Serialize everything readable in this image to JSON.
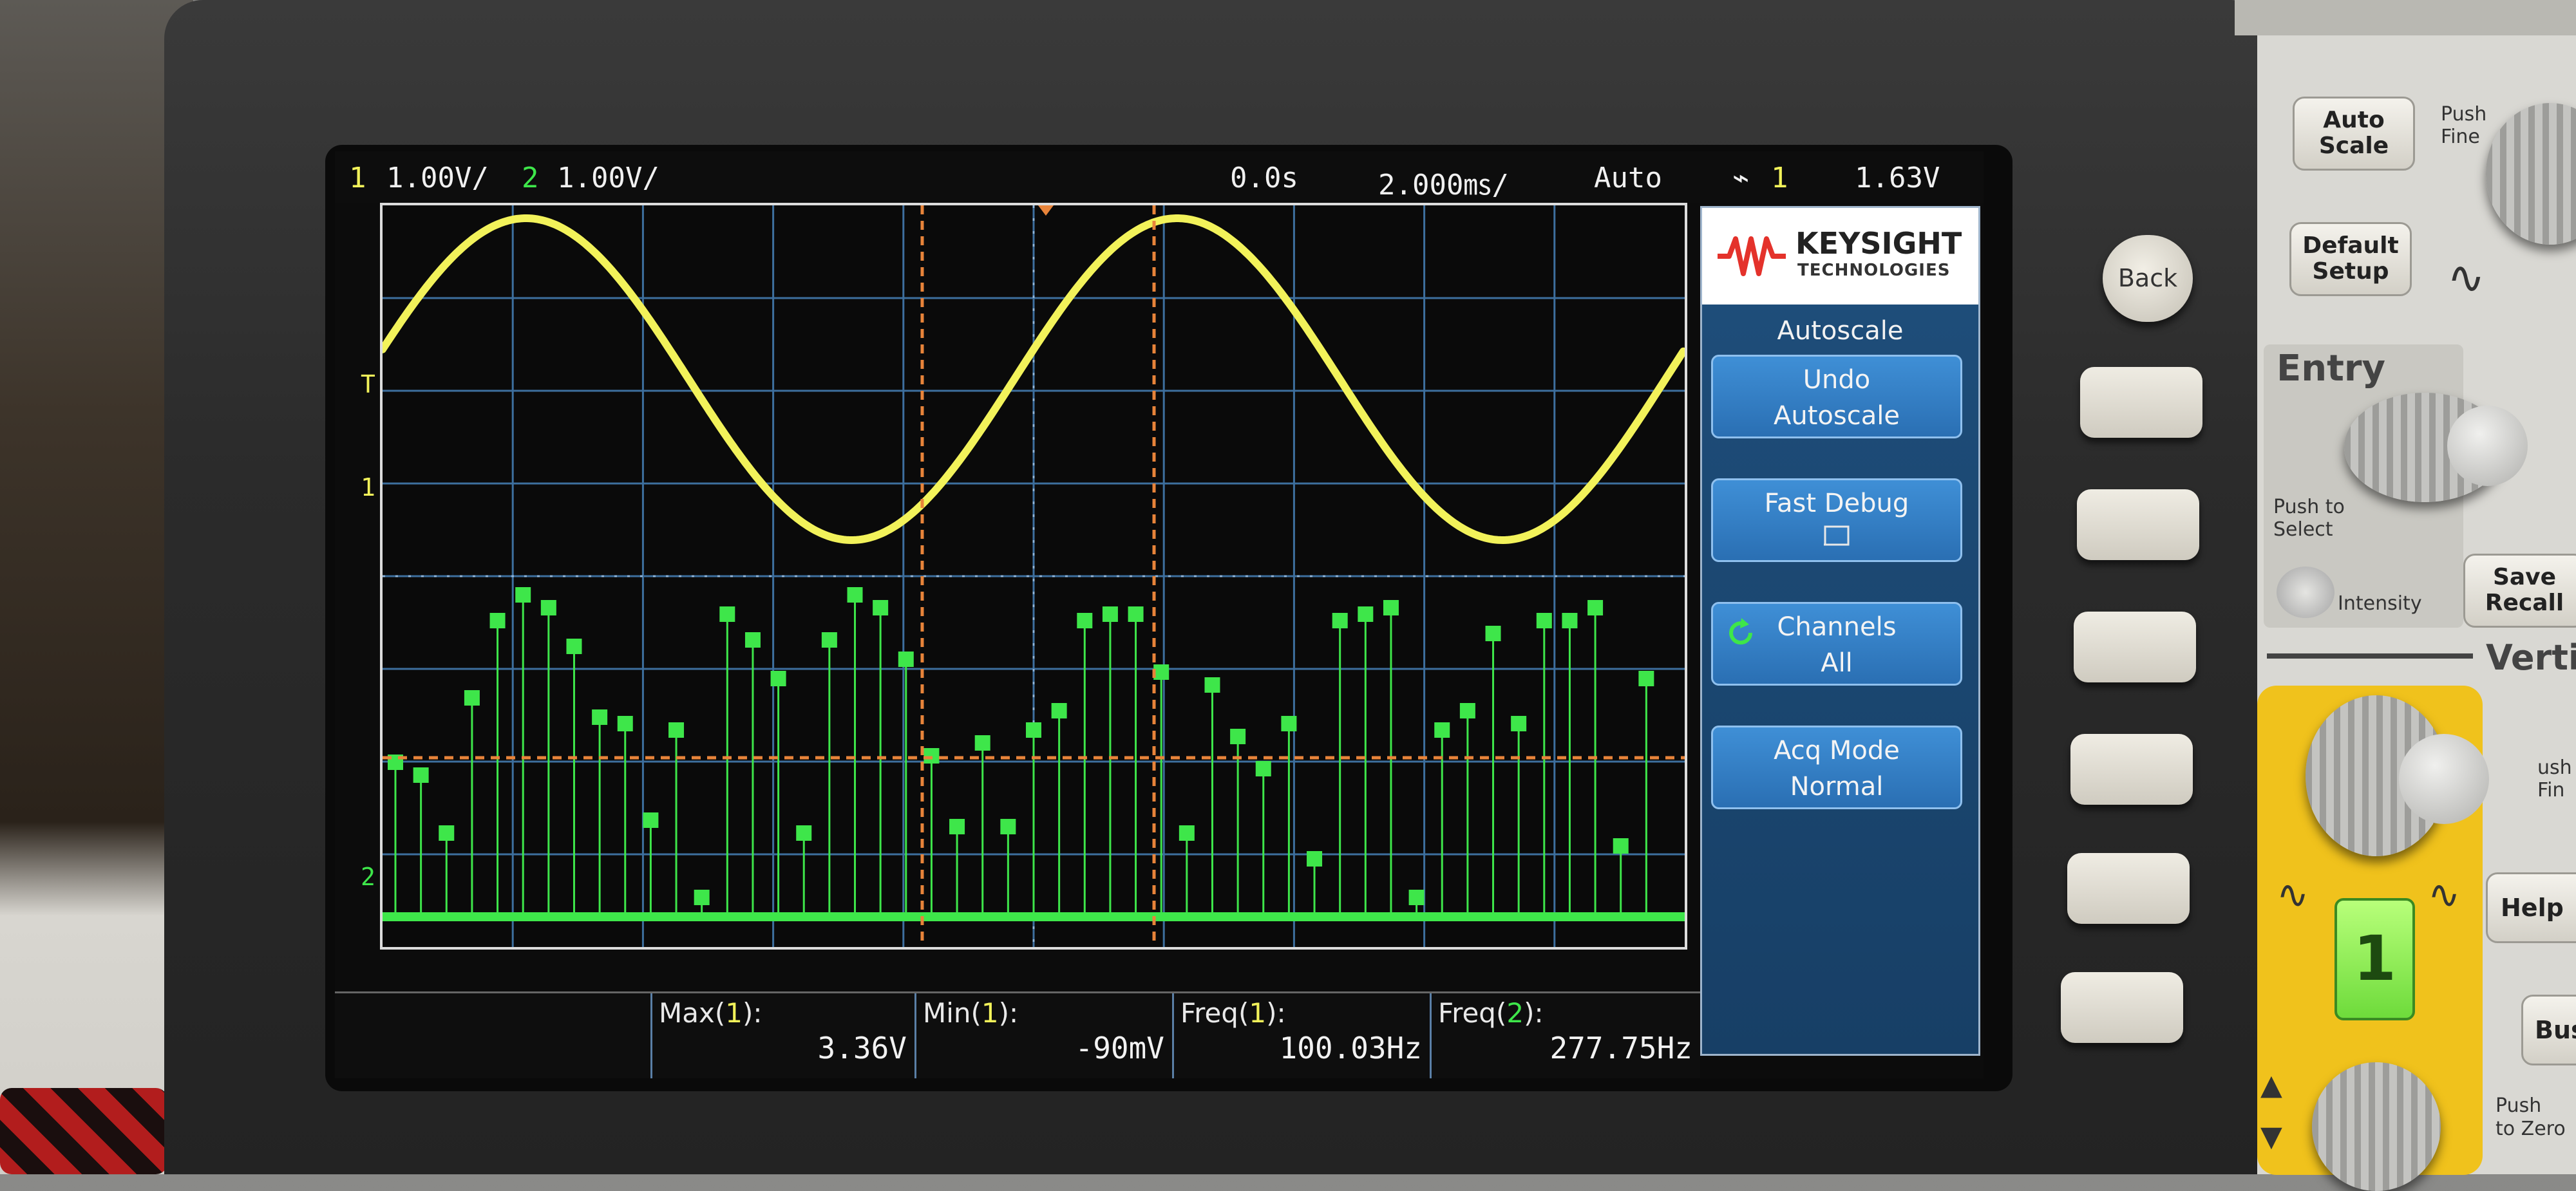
{
  "header": {
    "ch1_num": "1",
    "ch1_scale": "1.00V/",
    "ch2_num": "2",
    "ch2_scale": "1.00V/",
    "time_delay": "0.0s",
    "time_scale": "2.000㎳/",
    "trigger_mode": "Auto",
    "trigger_source": "1",
    "trigger_level": "1.63V"
  },
  "graticule_markers": {
    "trigger_mark": "T",
    "ch1_ground": "1",
    "ch2_ground": "2"
  },
  "menu": {
    "brand": "KEYSIGHT",
    "brand_sub": "TECHNOLOGIES",
    "title": "Autoscale",
    "softkeys": [
      {
        "line1": "Undo",
        "line2": "Autoscale"
      },
      {
        "line1": "Fast Debug",
        "line2": ""
      },
      {
        "line1": "Channels",
        "line2": "All"
      },
      {
        "line1": "Acq Mode",
        "line2": "Normal"
      }
    ]
  },
  "measurements": [
    {
      "name": "Max",
      "ch": "1",
      "value": "3.36V"
    },
    {
      "name": "Min",
      "ch": "1",
      "value": "-90mV"
    },
    {
      "name": "Freq",
      "ch": "1",
      "value": "100.03Hz"
    },
    {
      "name": "Freq",
      "ch": "2",
      "value": "277.75Hz"
    }
  ],
  "front_panel": {
    "back": "Back",
    "auto_scale": "Auto\nScale",
    "default_setup": "Default\nSetup",
    "push_fine_top": "Push\nFine",
    "entry": "Entry",
    "push_to_select": "Push to\nSelect",
    "intensity": "Intensity",
    "save_recall": "Save\nRecall",
    "vertical": "Vertic",
    "channel_key": "1",
    "help": "Help",
    "bus": "Bus",
    "push_to_zero": "Push\nto Zero",
    "push_fine_side": "ush\nFin"
  },
  "colors": {
    "ch1": "#f2f25a",
    "ch2": "#3ee64a",
    "cursor": "#e8843a",
    "grid": "#3d6f9e",
    "menu_key": "#2f7bc3"
  }
}
